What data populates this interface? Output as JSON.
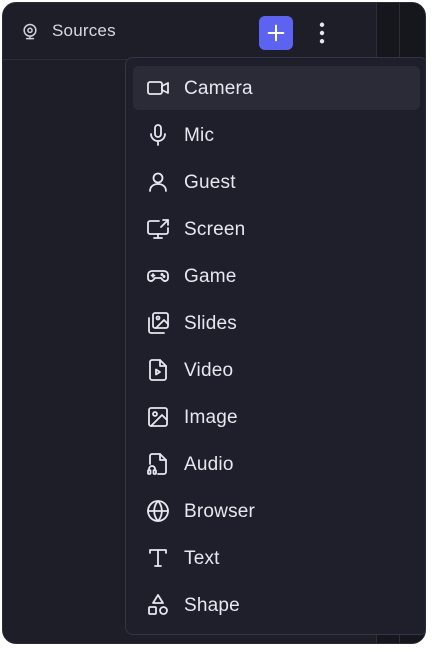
{
  "header": {
    "title": "Sources",
    "title_icon": "webcam-icon",
    "add_icon": "plus-icon",
    "more_icon": "more-vertical-icon"
  },
  "colors": {
    "background": "#1e1e28",
    "menu_background": "#1f1f2b",
    "accent": "#5b63f0",
    "text": "#e6e7ef"
  },
  "menu": {
    "items": [
      {
        "label": "Camera",
        "icon": "video-camera-icon",
        "active": true
      },
      {
        "label": "Mic",
        "icon": "microphone-icon"
      },
      {
        "label": "Guest",
        "icon": "user-icon"
      },
      {
        "label": "Screen",
        "icon": "screen-share-icon"
      },
      {
        "label": "Game",
        "icon": "gamepad-icon"
      },
      {
        "label": "Slides",
        "icon": "slides-icon"
      },
      {
        "label": "Video",
        "icon": "video-file-icon"
      },
      {
        "label": "Image",
        "icon": "image-icon"
      },
      {
        "label": "Audio",
        "icon": "audio-file-icon"
      },
      {
        "label": "Browser",
        "icon": "globe-icon"
      },
      {
        "label": "Text",
        "icon": "text-icon"
      },
      {
        "label": "Shape",
        "icon": "shapes-icon"
      }
    ]
  }
}
